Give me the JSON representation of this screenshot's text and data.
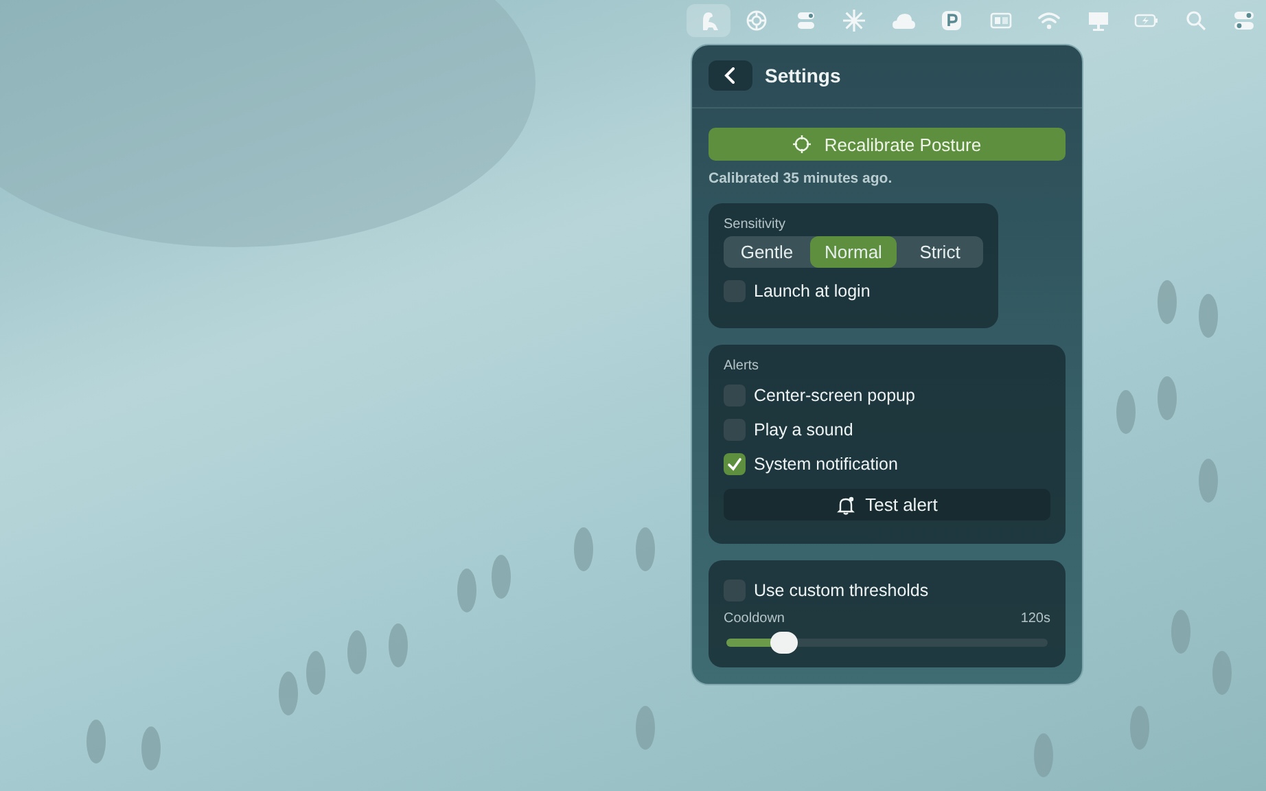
{
  "menu_bar": {
    "items": [
      {
        "selected": true
      },
      {
        "selected": false
      },
      {
        "selected": false
      },
      {
        "selected": false
      },
      {
        "selected": false
      },
      {
        "selected": false
      },
      {
        "selected": false
      },
      {
        "selected": false
      },
      {
        "selected": false
      },
      {
        "selected": false
      },
      {
        "selected": false
      },
      {
        "selected": false
      }
    ]
  },
  "panel": {
    "title": "Settings",
    "recalibrate_button": "Recalibrate Posture",
    "calibration_note": "Calibrated 35 minutes ago.",
    "sensitivity": {
      "label": "Sensitivity",
      "options": [
        {
          "label": "Gentle",
          "selected": false
        },
        {
          "label": "Normal",
          "selected": true
        },
        {
          "label": "Strict",
          "selected": false
        }
      ]
    },
    "launch_at_login": {
      "label": "Launch at login",
      "checked": false
    },
    "alerts": {
      "label": "Alerts",
      "options": [
        {
          "label": "Center-screen popup",
          "checked": false
        },
        {
          "label": "Play a sound",
          "checked": false
        },
        {
          "label": "System notification",
          "checked": true
        }
      ],
      "test_button": "Test alert"
    },
    "custom_thresholds": {
      "label": "Use custom thresholds",
      "checked": false
    },
    "cooldown": {
      "label": "Cooldown",
      "reading": "120s",
      "level": 0.18
    }
  }
}
